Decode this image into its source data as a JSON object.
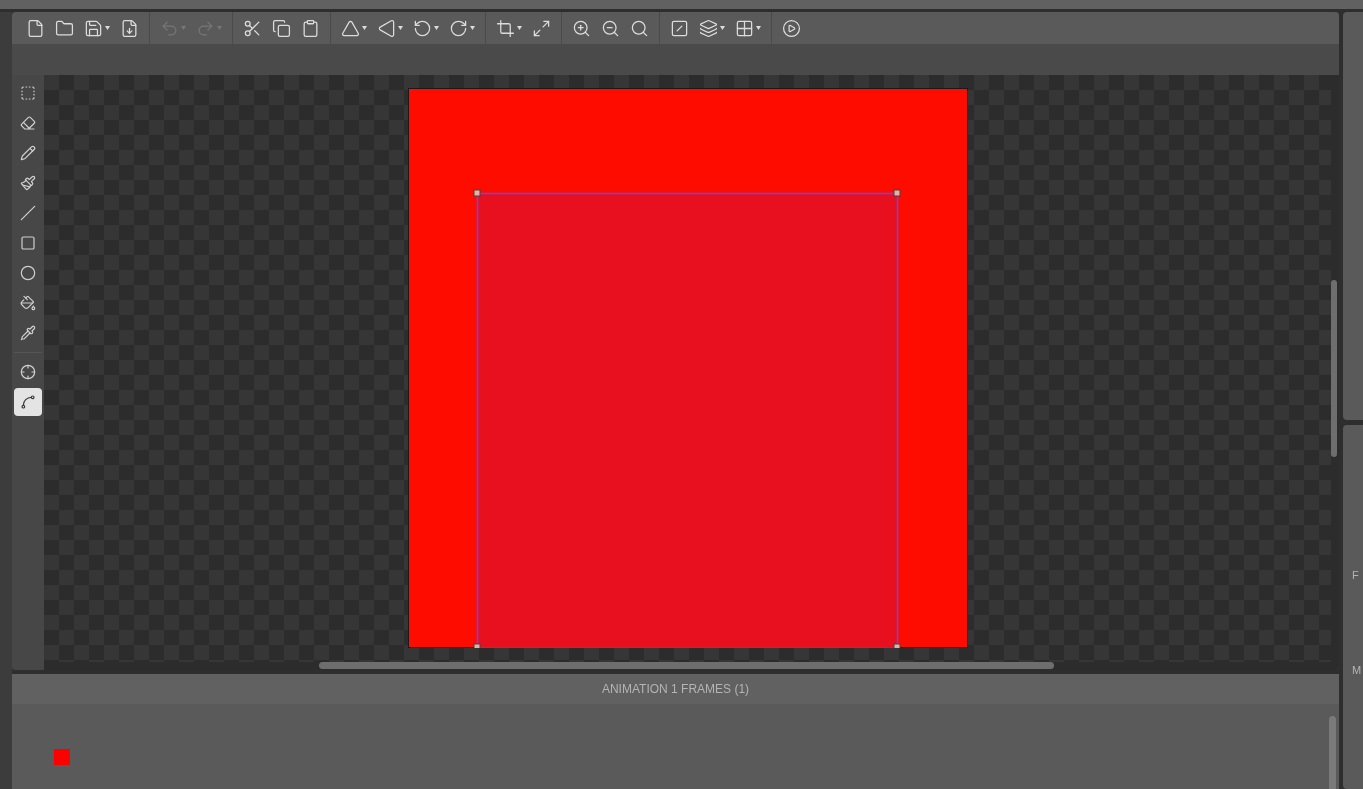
{
  "toolbar": {
    "groups": [
      [
        {
          "dropdown": false,
          "disabled": false
        },
        {
          "dropdown": false,
          "disabled": false
        },
        {
          "dropdown": true,
          "disabled": false
        },
        {
          "dropdown": false,
          "disabled": false
        }
      ],
      [
        {
          "dropdown": true,
          "disabled": true
        },
        {
          "dropdown": true,
          "disabled": true
        }
      ],
      [
        {
          "dropdown": false,
          "disabled": false
        },
        {
          "dropdown": false,
          "disabled": false
        },
        {
          "dropdown": false,
          "disabled": false
        }
      ],
      [
        {
          "dropdown": true,
          "disabled": false
        },
        {
          "dropdown": true,
          "disabled": false
        },
        {
          "dropdown": true,
          "disabled": false
        },
        {
          "dropdown": true,
          "disabled": false
        }
      ],
      [
        {
          "dropdown": true,
          "disabled": false
        },
        {
          "dropdown": false,
          "disabled": false
        }
      ],
      [
        {
          "dropdown": false,
          "disabled": false
        },
        {
          "dropdown": false,
          "disabled": false
        },
        {
          "dropdown": false,
          "disabled": false
        }
      ],
      [
        {
          "dropdown": false,
          "disabled": false
        },
        {
          "dropdown": true,
          "disabled": false
        },
        {
          "dropdown": true,
          "disabled": false
        }
      ],
      [
        {
          "dropdown": false,
          "disabled": false
        }
      ]
    ]
  },
  "tools": [
    [
      {
        "selected": false
      },
      {
        "selected": false
      },
      {
        "selected": false
      },
      {
        "selected": false
      },
      {
        "selected": false
      },
      {
        "selected": false
      },
      {
        "selected": false
      },
      {
        "selected": false
      },
      {
        "selected": false
      }
    ],
    [
      {
        "selected": false
      },
      {
        "selected": true
      }
    ]
  ],
  "frames_panel": {
    "title": "ANIMATION 1 FRAMES (1)",
    "frames": [
      {
        "selected": false
      }
    ]
  },
  "side_panel": {
    "labels": [
      "F",
      "M"
    ]
  }
}
